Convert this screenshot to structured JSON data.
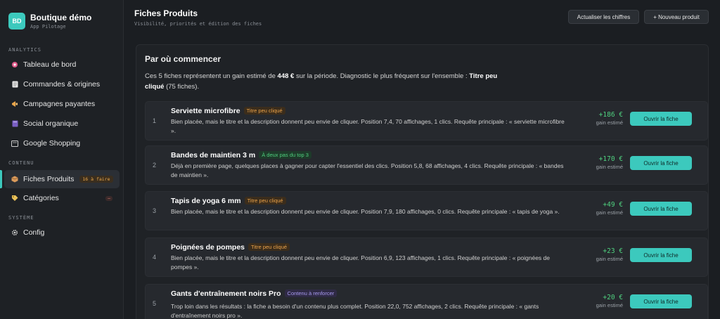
{
  "brand": {
    "logo": "BD",
    "title": "Boutique démo",
    "subtitle": "App Pilotage"
  },
  "sidebar": {
    "sections": [
      {
        "label": "ANALYTICS"
      },
      {
        "label": "CONTENU"
      },
      {
        "label": "SYSTÈME"
      }
    ],
    "items": [
      {
        "label": "Tableau de bord",
        "icon": "dashboard-icon"
      },
      {
        "label": "Commandes & origines",
        "icon": "document-icon"
      },
      {
        "label": "Campagnes payantes",
        "icon": "megaphone-icon"
      },
      {
        "label": "Social organique",
        "icon": "book-icon"
      },
      {
        "label": "Google Shopping",
        "icon": "shopping-icon"
      },
      {
        "label": "Fiches Produits",
        "icon": "box-icon",
        "badge": "16 à faire"
      },
      {
        "label": "Catégories",
        "icon": "tag-icon",
        "badge": "–"
      },
      {
        "label": "Config",
        "icon": "gear-icon"
      }
    ]
  },
  "header": {
    "title": "Fiches Produits",
    "subtitle": "Visibilité, priorités et édition des fiches",
    "refresh_label": "Actualiser les chiffres",
    "new_label": "+ Nouveau produit"
  },
  "panel": {
    "title": "Par où commencer",
    "intro_a": "Ces 5 fiches représentent un gain estimé de ",
    "intro_amount": "448 €",
    "intro_b": " sur la période. Diagnostic le plus fréquent sur l'ensemble : ",
    "intro_diag": "Titre peu cliqué",
    "intro_c": " (75 fiches).",
    "gain_label": "gain estimé",
    "open_label": "Ouvrir la fiche"
  },
  "products": [
    {
      "num": "1",
      "title": "Serviette microfibre",
      "tag": "Titre peu cliqué",
      "tag_color": "orange",
      "desc": "Bien placée, mais le titre et la description donnent peu envie de cliquer. Position 7,4, 70 affichages, 1 clics. Requête principale : « serviette microfibre ».",
      "gain": "+186 €"
    },
    {
      "num": "2",
      "title": "Bandes de maintien 3 m",
      "tag": "À deux pas du top 3",
      "tag_color": "green",
      "desc": "Déjà en première page, quelques places à gagner pour capter l'essentiel des clics. Position 5,8, 68 affichages, 4 clics. Requête principale : « bandes de maintien ».",
      "gain": "+170 €"
    },
    {
      "num": "3",
      "title": "Tapis de yoga 6 mm",
      "tag": "Titre peu cliqué",
      "tag_color": "orange",
      "desc": "Bien placée, mais le titre et la description donnent peu envie de cliquer. Position 7,9, 180 affichages, 0 clics. Requête principale : « tapis de yoga ».",
      "gain": "+49 €"
    },
    {
      "num": "4",
      "title": "Poignées de pompes",
      "tag": "Titre peu cliqué",
      "tag_color": "orange",
      "desc": "Bien placée, mais le titre et la description donnent peu envie de cliquer. Position 6,9, 123 affichages, 1 clics. Requête principale : « poignées de pompes ».",
      "gain": "+23 €"
    },
    {
      "num": "5",
      "title": "Gants d'entraînement noirs Pro",
      "tag": "Contenu à renforcer",
      "tag_color": "purple",
      "desc": "Trop loin dans les résultats : la fiche a besoin d'un contenu plus complet. Position 22,0, 752 affichages, 2 clics. Requête principale : « gants d'entraînement noirs pro ».",
      "gain": "+20 €"
    }
  ]
}
